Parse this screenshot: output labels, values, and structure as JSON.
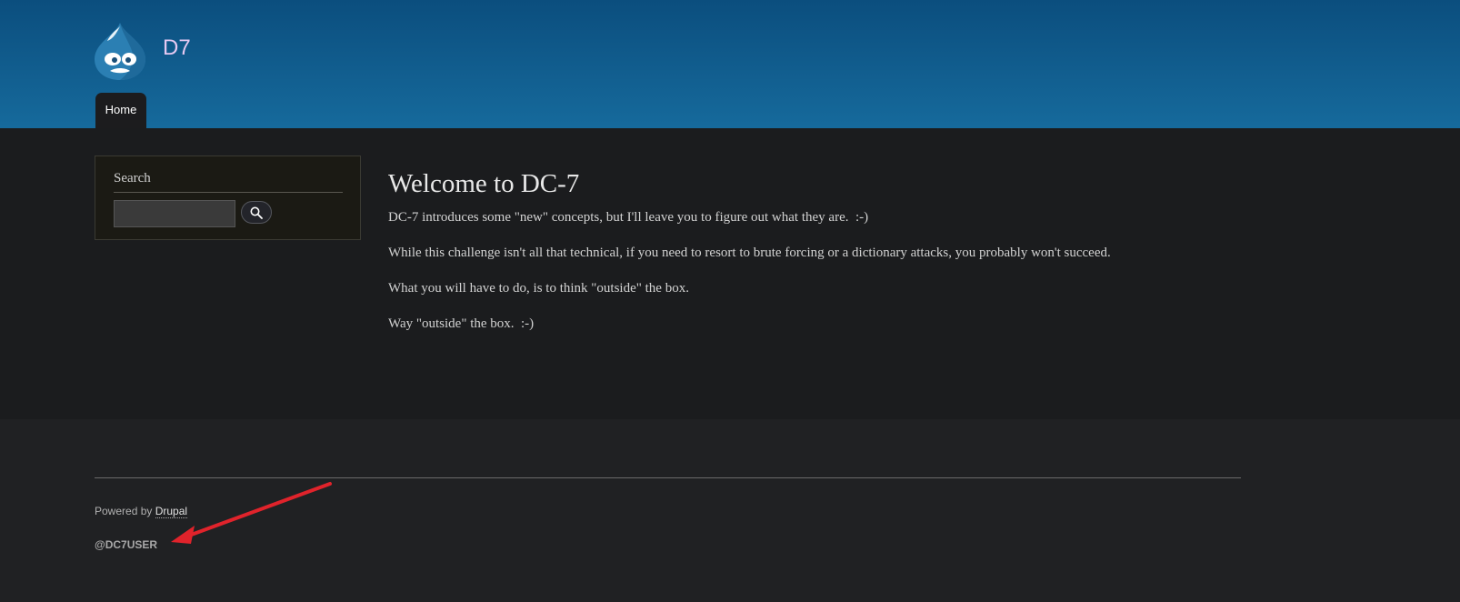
{
  "header": {
    "site_name": "D7",
    "logo_icon": "drupal-drop-logo-icon",
    "nav": [
      {
        "label": "Home",
        "active": true
      }
    ]
  },
  "sidebar": {
    "search": {
      "title": "Search",
      "input_value": "",
      "button_icon": "search-icon"
    }
  },
  "main": {
    "title": "Welcome to DC-7",
    "paragraphs": [
      "DC-7 introduces some \"new\" concepts, but I'll leave you to figure out what they are.  :-)",
      "While this challenge isn't all that technical, if you need to resort to brute forcing or a dictionary attacks, you probably won't succeed.",
      "What you will have to do, is to think \"outside\" the box.",
      "Way \"outside\" the box.  :-)"
    ]
  },
  "footer": {
    "powered_prefix": "Powered by ",
    "powered_link": "Drupal",
    "handle": "@DC7USER"
  },
  "annotation": {
    "type": "arrow",
    "color": "#e0232b"
  },
  "colors": {
    "header_top": "#0b4e7e",
    "header_bottom": "#166a9c",
    "main_bg": "#1b1c1e",
    "footer_bg": "#202123",
    "site_name": "#e6c9f2"
  }
}
